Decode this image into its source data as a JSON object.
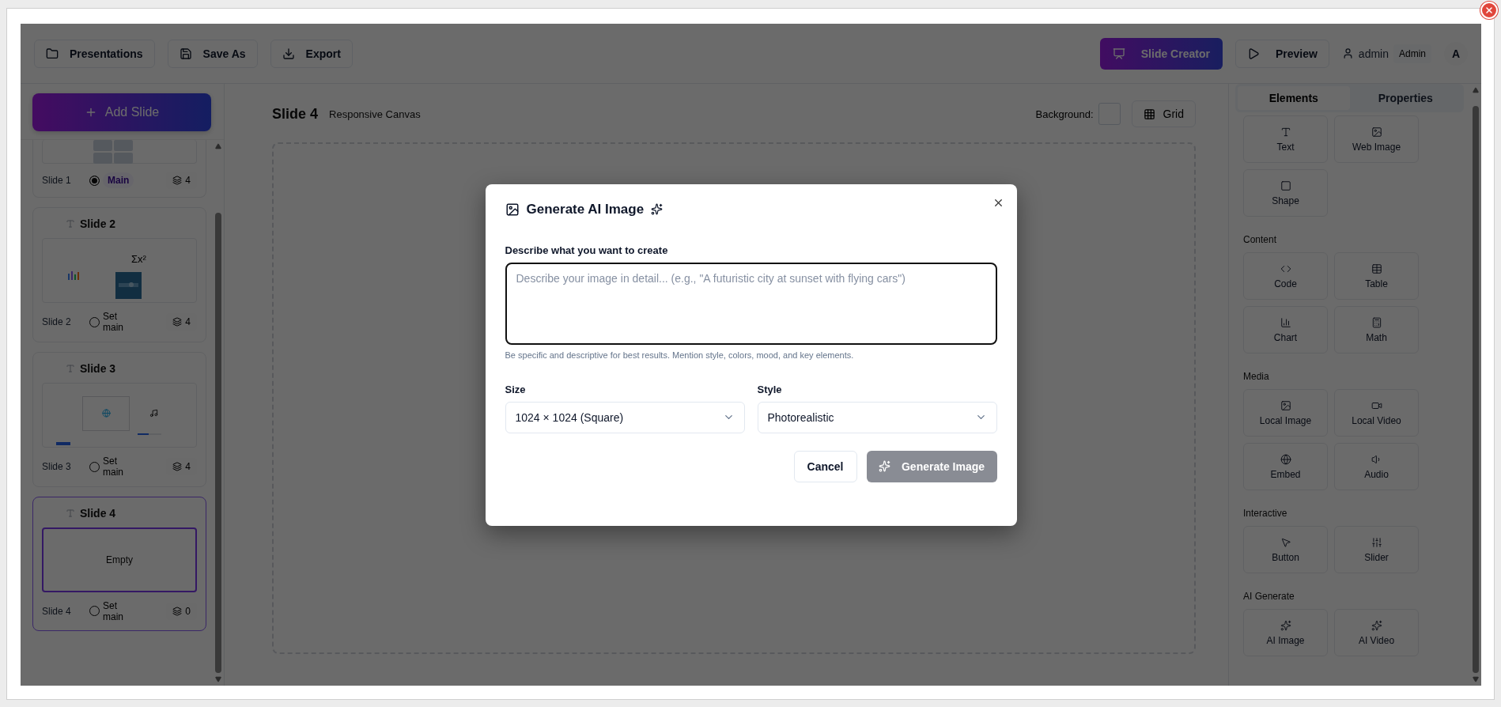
{
  "toolbar": {
    "left_buttons": [
      "Presentations",
      "Save As",
      "Export"
    ],
    "creator_button": "Slide Creator",
    "preview_button": "Preview",
    "user_name": "admin",
    "role_badge": "Admin",
    "avatar_initial": "A"
  },
  "sidebar": {
    "add_button": "Add Slide",
    "slides": [
      {
        "kind": "table",
        "footer": "Slide 1",
        "main": true,
        "main_label": "Main",
        "layers": "4",
        "selected": false
      },
      {
        "kind": "chart",
        "title": "Slide 2",
        "formula": "Σx²",
        "footer": "Slide 2",
        "main": false,
        "main_label": "Set main",
        "layers": "4",
        "selected": false
      },
      {
        "kind": "media",
        "title": "Slide 3",
        "footer": "Slide 3",
        "main": false,
        "main_label": "Set main",
        "layers": "4",
        "selected": false
      },
      {
        "kind": "empty",
        "title": "Slide 4",
        "empty_label": "Empty",
        "footer": "Slide 4",
        "main": false,
        "main_label": "Set main",
        "layers": "0",
        "selected": true
      }
    ]
  },
  "canvas": {
    "title": "Slide 4",
    "subtitle": "Responsive Canvas",
    "background_label": "Background:",
    "grid_button": "Grid"
  },
  "panel": {
    "tabs": [
      {
        "label": "Elements",
        "selected": true
      },
      {
        "label": "Properties",
        "selected": false
      }
    ],
    "sections": [
      {
        "items": [
          "Text",
          "Web Image",
          "Shape"
        ]
      },
      {
        "heading": "Content",
        "items": [
          "Code",
          "Table",
          "Chart",
          "Math"
        ]
      },
      {
        "heading": "Media",
        "items": [
          "Local Image",
          "Local Video",
          "Embed",
          "Audio"
        ]
      },
      {
        "heading": "Interactive",
        "items": [
          "Button",
          "Slider"
        ]
      },
      {
        "heading": "AI Generate",
        "items": [
          "AI Image",
          "AI Video"
        ]
      }
    ]
  },
  "dialog": {
    "title": "Generate AI Image",
    "prompt_label": "Describe what you want to create",
    "prompt_placeholder": "Describe your image in detail... (e.g., \"A futuristic city at sunset with flying cars\")",
    "hint": "Be specific and descriptive for best results. Mention style, colors, mood, and key elements.",
    "size_label": "Size",
    "size_value": "1024 × 1024 (Square)",
    "style_label": "Style",
    "style_value": "Photorealistic",
    "cancel_button": "Cancel",
    "generate_button": {
      "label": "Generate Image",
      "disabled": true
    }
  }
}
